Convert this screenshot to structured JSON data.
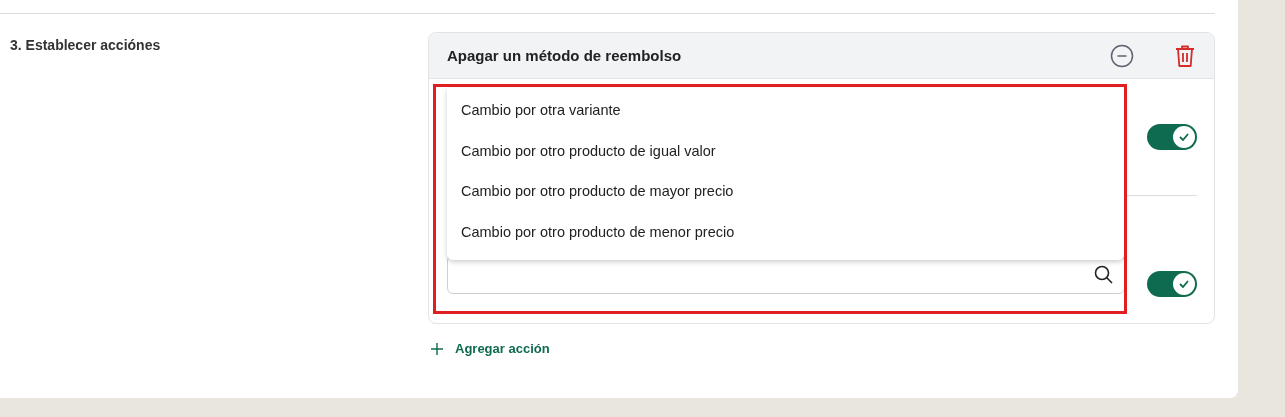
{
  "section": {
    "label": "3. Establecer acciónes"
  },
  "action": {
    "title": "Apagar un método de reembolso",
    "dropdown": {
      "options": [
        "Cambio por otra variante",
        "Cambio por otro producto de igual valor",
        "Cambio por otro producto de mayor precio",
        "Cambio por otro producto de menor precio"
      ]
    },
    "toggles": [
      {
        "on": true
      },
      {
        "on": true
      }
    ]
  },
  "add_action": {
    "label": "Agregar acción"
  }
}
